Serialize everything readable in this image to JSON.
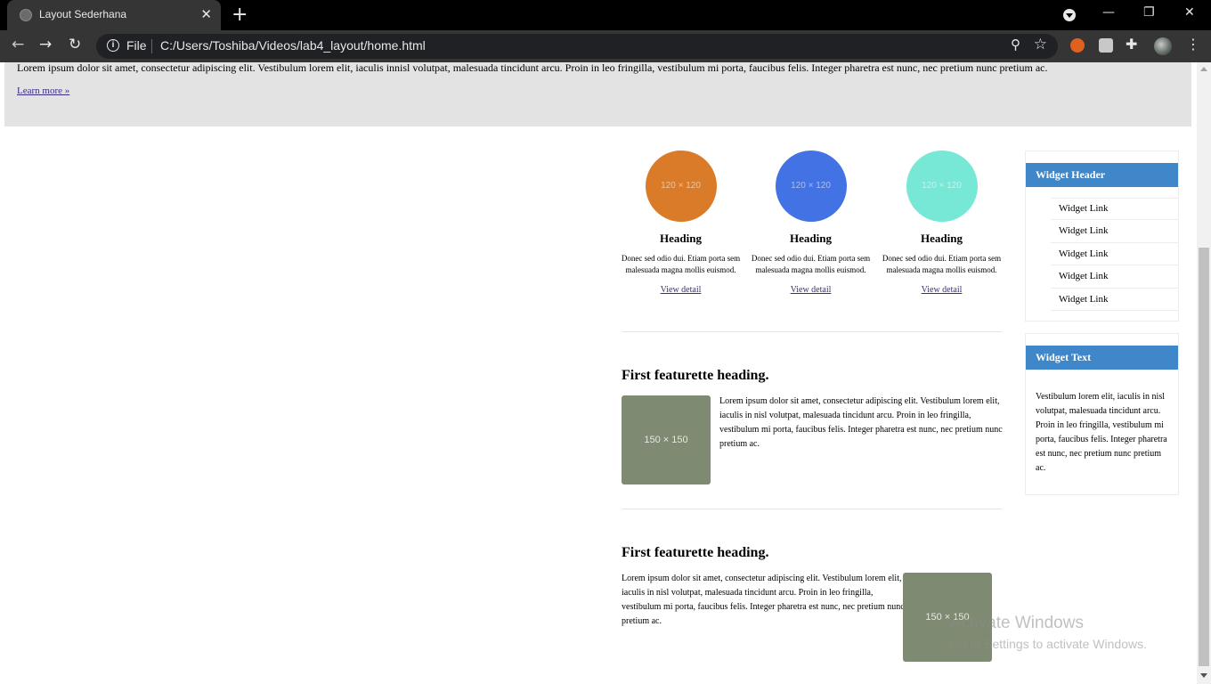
{
  "browser": {
    "tab_title": "Layout Sederhana",
    "scheme_label": "File",
    "url": "C:/Users/Toshiba/Videos/lab4_layout/home.html"
  },
  "jumbotron": {
    "text": "Lorem ipsum dolor sit amet, consectetur adipiscing elit. Vestibulum lorem elit, iaculis innisl volutpat, malesuada tincidunt arcu. Proin in leo fringilla, vestibulum mi porta, faucibus felis. Integer pharetra est nunc, nec pretium nunc pretium ac.",
    "link": "Learn more »"
  },
  "columns": [
    {
      "placeholder": "120 × 120",
      "color": "#d97b28",
      "heading": "Heading",
      "text": "Donec sed odio dui. Etiam porta sem malesuada magna mollis euismod.",
      "link": "View detail"
    },
    {
      "placeholder": "120 × 120",
      "color": "#4272e3",
      "heading": "Heading",
      "text": "Donec sed odio dui. Etiam porta sem malesuada magna mollis euismod.",
      "link": "View detail"
    },
    {
      "placeholder": "120 × 120",
      "color": "#77e8d5",
      "heading": "Heading",
      "text": "Donec sed odio dui. Etiam porta sem malesuada magna mollis euismod.",
      "link": "View detail"
    }
  ],
  "featurettes": [
    {
      "heading": "First featurette heading.",
      "image": "150 × 150",
      "text": "Lorem ipsum dolor sit amet, consectetur adipiscing elit. Vestibulum lorem elit, iaculis in nisl volutpat, malesuada tincidunt arcu. Proin in leo fringilla, vestibulum mi porta, faucibus felis. Integer pharetra est nunc, nec pretium nunc pretium ac."
    },
    {
      "heading": "First featurette heading.",
      "image": "150 × 150",
      "text": "Lorem ipsum dolor sit amet, consectetur adipiscing elit. Vestibulum lorem elit, iaculis in nisl volutpat, malesuada tincidunt arcu. Proin in leo fringilla, vestibulum mi porta, faucibus felis. Integer pharetra est nunc, nec pretium nunc pretium ac."
    }
  ],
  "widgets": {
    "links_header": "Widget Header",
    "links": [
      "Widget Link",
      "Widget Link",
      "Widget Link",
      "Widget Link",
      "Widget Link"
    ],
    "text_header": "Widget Text",
    "text": "Vestibulum lorem elit, iaculis in nisl volutpat, malesuada tincidunt arcu. Proin in leo fringilla, vestibulum mi porta, faucibus felis. Integer pharetra est nunc, nec pretium nunc pretium ac."
  },
  "watermark": {
    "line1": "Activate Windows",
    "line2": "Go to Settings to activate Windows."
  },
  "colors": {
    "widget_header": "#3f87c8",
    "jumbotron_bg": "#e3e3e3",
    "featurette_image": "#7e8a71"
  }
}
